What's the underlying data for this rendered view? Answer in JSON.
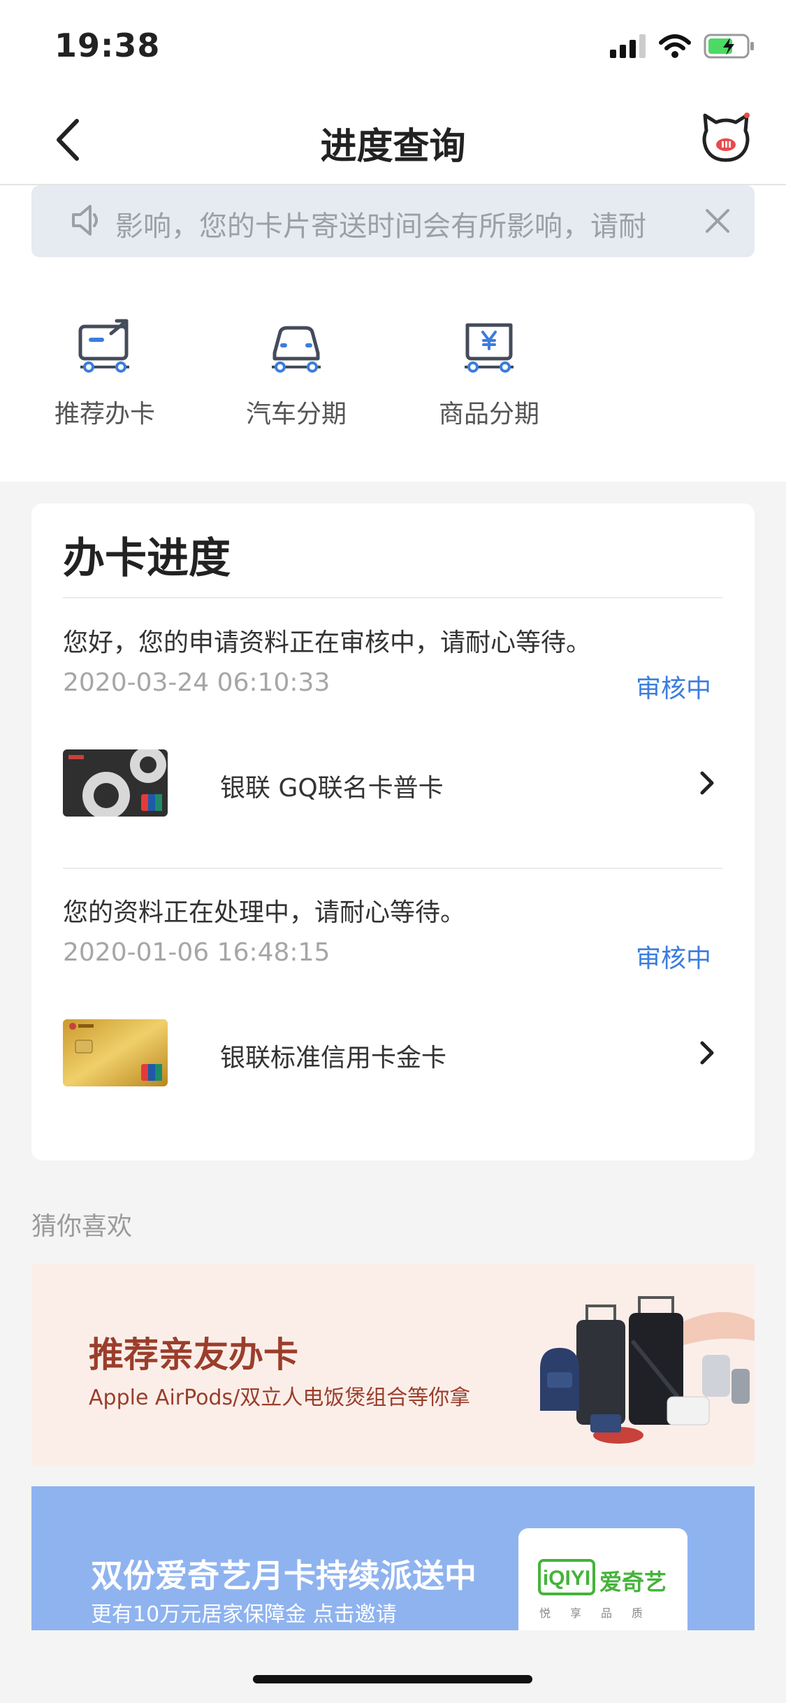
{
  "status_bar": {
    "time": "19:38"
  },
  "nav": {
    "title": "进度查询"
  },
  "notice": {
    "text": "影响，您的卡片寄送时间会有所影响，请耐"
  },
  "quick_actions": [
    {
      "label": "推荐办卡",
      "icon": "card-share-icon"
    },
    {
      "label": "汽车分期",
      "icon": "car-icon"
    },
    {
      "label": "商品分期",
      "icon": "product-yen-icon"
    }
  ],
  "progress": {
    "title": "办卡进度",
    "applications": [
      {
        "message": "您好，您的申请资料正在审核中，请耐心等待。",
        "date": "2020-03-24 06:10:33",
        "status": "审核中",
        "product": "银联 GQ联名卡普卡"
      },
      {
        "message": "您的资料正在处理中，请耐心等待。",
        "date": "2020-01-06 16:48:15",
        "status": "审核中",
        "product": "银联标准信用卡金卡"
      }
    ]
  },
  "recommend": {
    "label": "猜你喜欢",
    "banner1": {
      "title": "推荐亲友办卡",
      "subtitle": "Apple AirPods/双立人电饭煲组合等你拿"
    },
    "banner2": {
      "title": "双份爱奇艺月卡持续派送中",
      "subtitle": "更有10万元居家保障金 点击邀请",
      "brand": "爱奇艺",
      "slogan": "悦享品质"
    }
  },
  "colors": {
    "accent": "#3b7ddd",
    "banner1_bg": "#fbeee9",
    "banner2_bg": "#8fb3ef"
  }
}
